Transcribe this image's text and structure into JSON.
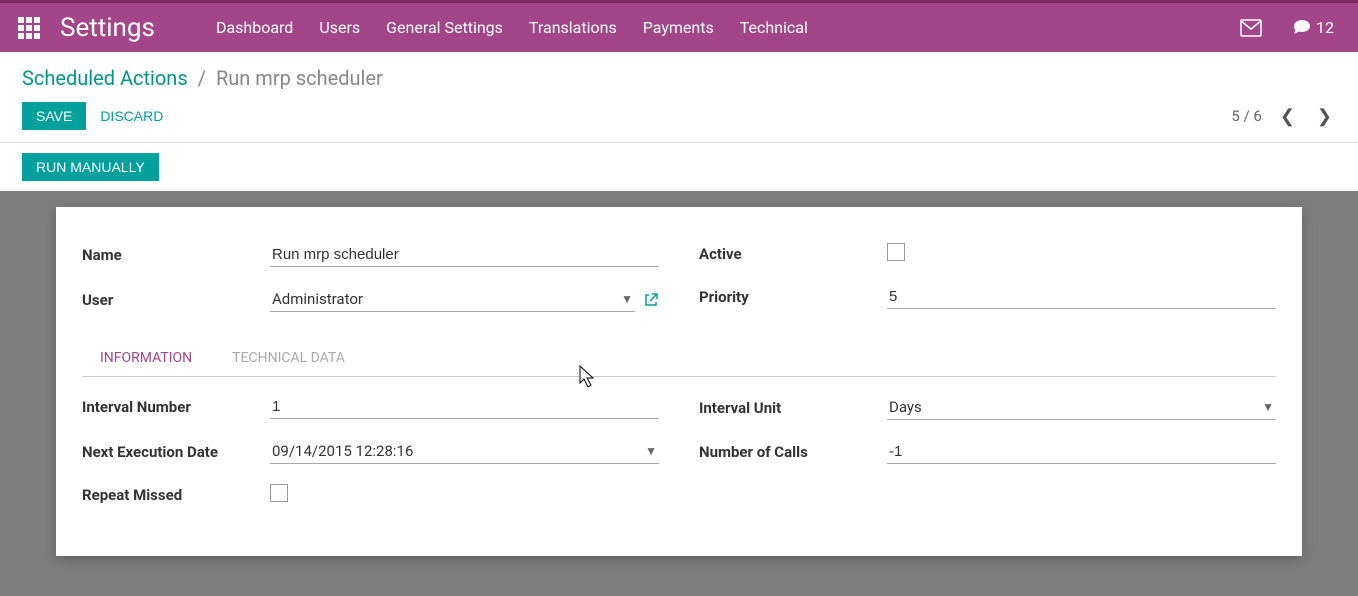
{
  "topbar": {
    "title": "Settings",
    "menu": [
      "Dashboard",
      "Users",
      "General Settings",
      "Translations",
      "Payments",
      "Technical"
    ],
    "msg_count": "12"
  },
  "breadcrumb": {
    "parent": "Scheduled Actions",
    "current": "Run mrp scheduler"
  },
  "actions": {
    "save": "Save",
    "discard": "Discard",
    "run": "Run Manually"
  },
  "pager": {
    "text": "5 / 6"
  },
  "form": {
    "labels": {
      "name": "Name",
      "user": "User",
      "active": "Active",
      "priority": "Priority",
      "interval_number": "Interval Number",
      "next_execution_date": "Next Execution Date",
      "repeat_missed": "Repeat Missed",
      "interval_unit": "Interval Unit",
      "number_of_calls": "Number of Calls"
    },
    "values": {
      "name": "Run mrp scheduler",
      "user": "Administrator",
      "active": false,
      "priority": "5",
      "interval_number": "1",
      "next_execution_date": "09/14/2015 12:28:16",
      "repeat_missed": false,
      "interval_unit": "Days",
      "number_of_calls": "-1"
    }
  },
  "tabs": {
    "information": "Information",
    "technical_data": "Technical Data"
  }
}
